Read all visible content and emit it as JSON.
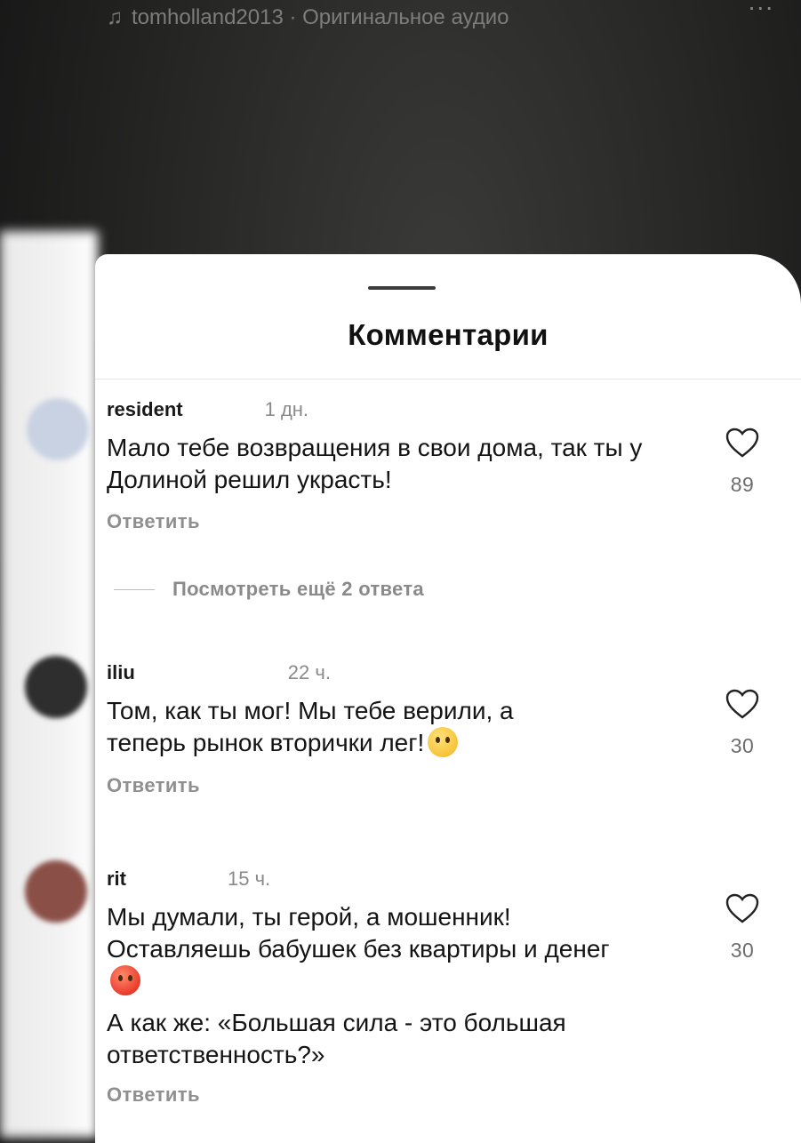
{
  "audio": {
    "icon": "music-note-icon",
    "label": "tomholland2013 · Оригинальное аудио",
    "more": "..."
  },
  "sheet": {
    "title": "Комментарии"
  },
  "comments": [
    {
      "username": "resident",
      "time": "1 дн.",
      "lines": [
        "Мало тебе возвращения в свои дома,  так ты у Долиной решил украсть!"
      ],
      "likes": "89",
      "reply_label": "Ответить",
      "avatar_color": "#c9d2e2"
    },
    {
      "username": "iliu",
      "time": "22 ч.",
      "lines": [
        "Том, как ты мог! Мы тебе верили, а теперь рынок вторички лег!"
      ],
      "emoji": "astonished-face",
      "likes": "30",
      "reply_label": "Ответить",
      "avatar_color": "#2e2e2e"
    },
    {
      "username": "rit",
      "time": "15 ч.",
      "lines": [
        "Мы думали, ты герой, а мошенник! Оставляешь бабушек без квартиры и денег",
        "А как же: «Большая сила - это большая ответственность?»"
      ],
      "emoji": "angry-face",
      "likes": "30",
      "reply_label": "Ответить",
      "avatar_color": "#8a5048"
    }
  ],
  "thread": {
    "view_more_label": "Посмотреть ещё 2 ответа"
  },
  "colors": {
    "sheet_bg": "#ffffff",
    "text": "#141414",
    "muted": "#8a8a8a"
  }
}
